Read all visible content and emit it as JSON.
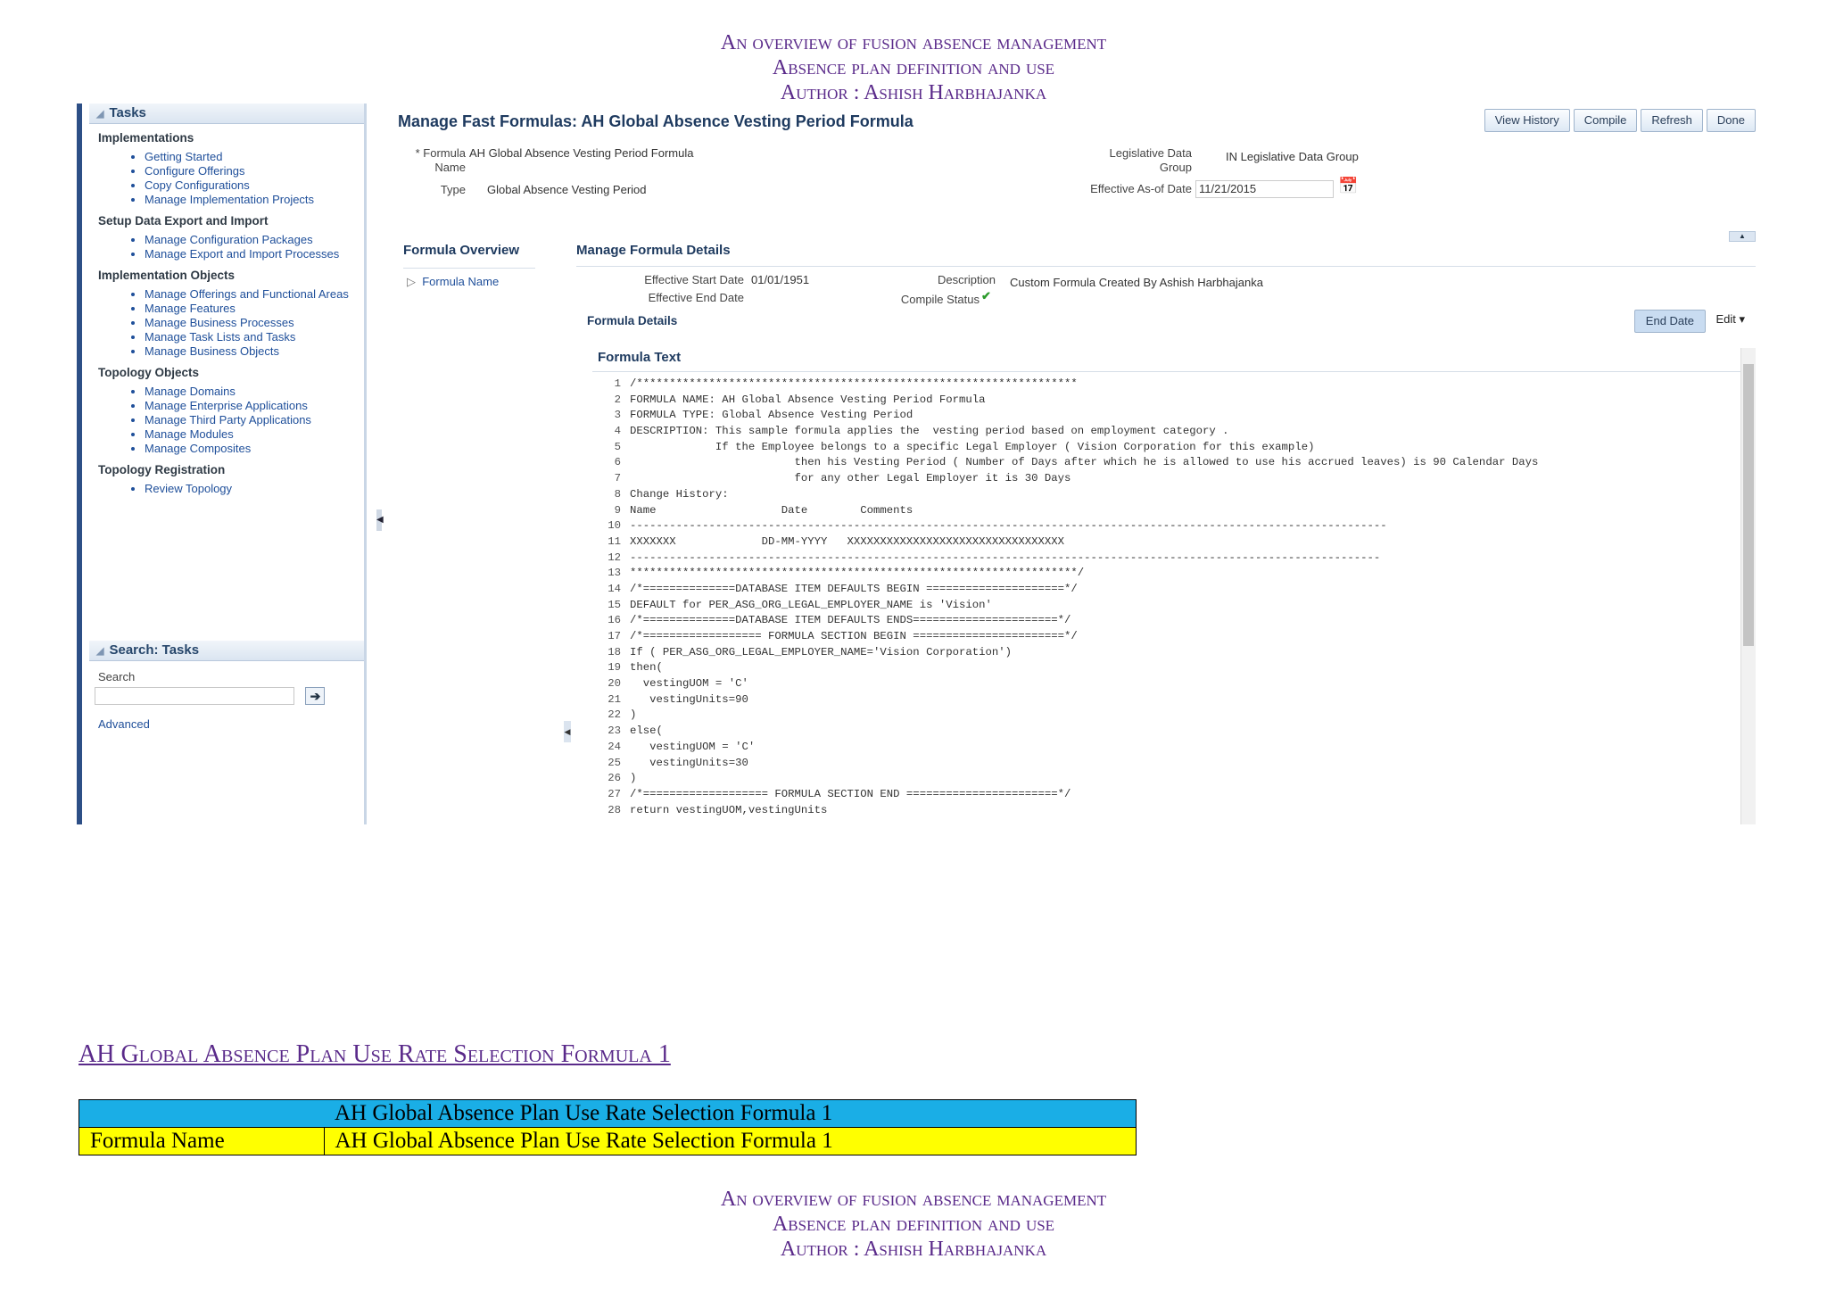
{
  "page_header": {
    "line1": "An overview of fusion absence management",
    "line2": "Absence plan definition and use",
    "line3": "Author : Ashish Harbhajanka"
  },
  "screenshot": {
    "left_panel": {
      "tasks_title": "Tasks",
      "sections": [
        {
          "title": "Implementations",
          "items": [
            "Getting Started",
            "Configure Offerings",
            "Copy Configurations",
            "Manage Implementation Projects"
          ]
        },
        {
          "title": "Setup Data Export and Import",
          "items": [
            "Manage Configuration Packages",
            "Manage Export and Import Processes"
          ]
        },
        {
          "title": "Implementation Objects",
          "items": [
            "Manage Offerings and Functional Areas",
            "Manage Features",
            "Manage Business Processes",
            "Manage Task Lists and Tasks",
            "Manage Business Objects"
          ]
        },
        {
          "title": "Topology Objects",
          "items": [
            "Manage Domains",
            "Manage Enterprise Applications",
            "Manage Third Party Applications",
            "Manage Modules",
            "Manage Composites"
          ]
        },
        {
          "title": "Topology Registration",
          "items": [
            "Review Topology"
          ]
        }
      ],
      "search_title": "Search: Tasks",
      "search_label": "Search",
      "advanced_label": "Advanced"
    },
    "main": {
      "title": "Manage Fast Formulas: AH Global Absence Vesting Period Formula",
      "buttons": [
        "View History",
        "Compile",
        "Refresh",
        "Done"
      ],
      "formula_name_label": "* Formula Name",
      "formula_name_value": "AH Global Absence Vesting Period Formula",
      "type_label": "Type",
      "type_value": "Global Absence Vesting Period",
      "leg_group_label": "Legislative Data Group",
      "leg_group_value": "IN Legislative Data Group",
      "eff_asof_label": "Effective As-of Date",
      "eff_asof_value": "11/21/2015",
      "overview_title": "Formula Overview",
      "details_title": "Manage Formula Details",
      "formula_name_link": "Formula Name",
      "eff_start_label": "Effective Start Date",
      "eff_start_value": "01/01/1951",
      "eff_end_label": "Effective End Date",
      "description_label": "Description",
      "description_value": "Custom Formula Created By Ashish Harbhajanka",
      "compile_status_label": "Compile Status",
      "formula_details_title": "Formula Details",
      "end_date_button": "End Date",
      "edit_menu": "Edit ▾",
      "formula_text_title": "Formula Text",
      "code_lines": [
        "/*******************************************************************",
        "FORMULA NAME: AH Global Absence Vesting Period Formula",
        "FORMULA TYPE: Global Absence Vesting Period",
        "DESCRIPTION: This sample formula applies the  vesting period based on employment category .",
        "             If the Employee belongs to a specific Legal Employer ( Vision Corporation for this example)",
        "                         then his Vesting Period ( Number of Days after which he is allowed to use his accrued leaves) is 90 Calendar Days",
        "                         for any other Legal Employer it is 30 Days",
        "Change History:",
        "Name                   Date        Comments",
        "-------------------------------------------------------------------------------------------------------------------",
        "XXXXXXX             DD-MM-YYYY   XXXXXXXXXXXXXXXXXXXXXXXXXXXXXXXXX",
        "------------------------------------------------------------------------------------------------------------------",
        "********************************************************************/",
        "/*==============DATABASE ITEM DEFAULTS BEGIN =====================*/",
        "DEFAULT for PER_ASG_ORG_LEGAL_EMPLOYER_NAME is 'Vision'",
        "/*==============DATABASE ITEM DEFAULTS ENDS======================*/",
        "/*================== FORMULA SECTION BEGIN =======================*/",
        "If ( PER_ASG_ORG_LEGAL_EMPLOYER_NAME='Vision Corporation')",
        "then(",
        "  vestingUOM = 'C'",
        "   vestingUnits=90",
        ")",
        "else(",
        "   vestingUOM = 'C'",
        "   vestingUnits=30",
        ")",
        "/*=================== FORMULA SECTION END =======================*/",
        "return vestingUOM,vestingUnits"
      ]
    }
  },
  "section_title": "AH Global Absence Plan Use Rate Selection Formula 1",
  "table": {
    "header_value": "AH Global Absence Plan Use Rate Selection Formula 1",
    "row_label": "Formula Name",
    "row_value": "AH Global Absence Plan Use Rate Selection Formula 1"
  },
  "colors": {
    "header_purple": "#5a2a8a",
    "table_header": "#1aaee6",
    "table_row": "#ffff00"
  }
}
